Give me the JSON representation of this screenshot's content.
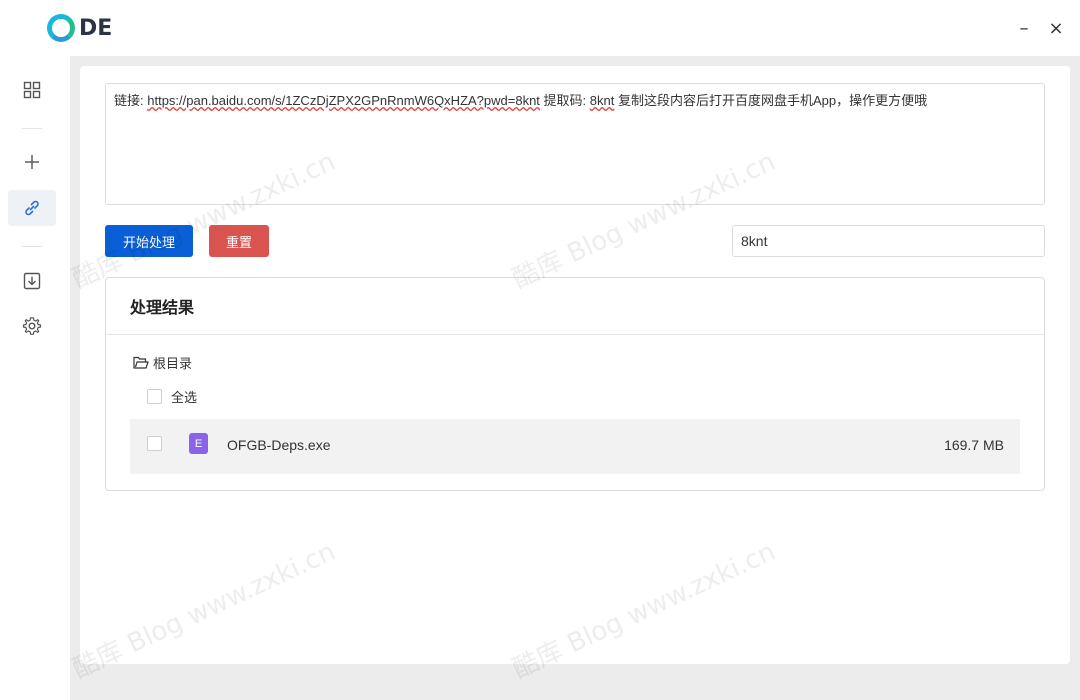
{
  "app": {
    "logo_text": "DE"
  },
  "window": {
    "minimize": "–",
    "close": "×"
  },
  "sidebar": {
    "items": [
      {
        "icon": "grid-icon"
      },
      {
        "icon": "plus-icon"
      },
      {
        "icon": "link-icon",
        "active": true
      },
      {
        "icon": "download-icon"
      },
      {
        "icon": "gear-icon"
      }
    ]
  },
  "link_box": {
    "prefix": "链接: ",
    "url": "https://pan.baidu.com/s/1ZCzDjZPX2GPnRnmW6QxHZA?pwd=8knt",
    "code_label": " 提取码: ",
    "code": "8knt",
    "suffix": " 复制这段内容后打开百度网盘手机App，操作更方便哦"
  },
  "buttons": {
    "start": "开始处理",
    "reset": "重置"
  },
  "code_input": {
    "value": "8knt"
  },
  "result": {
    "title": "处理结果",
    "root_label": "根目录",
    "select_all": "全选",
    "files": [
      {
        "icon_letter": "E",
        "name": "OFGB-Deps.exe",
        "size": "169.7 MB"
      }
    ]
  },
  "watermark": {
    "text": "酷库 Blog  www.zxki.cn"
  },
  "colors": {
    "primary": "#0b5fd6",
    "danger": "#d9534f",
    "file_icon": "#8b63e8"
  }
}
